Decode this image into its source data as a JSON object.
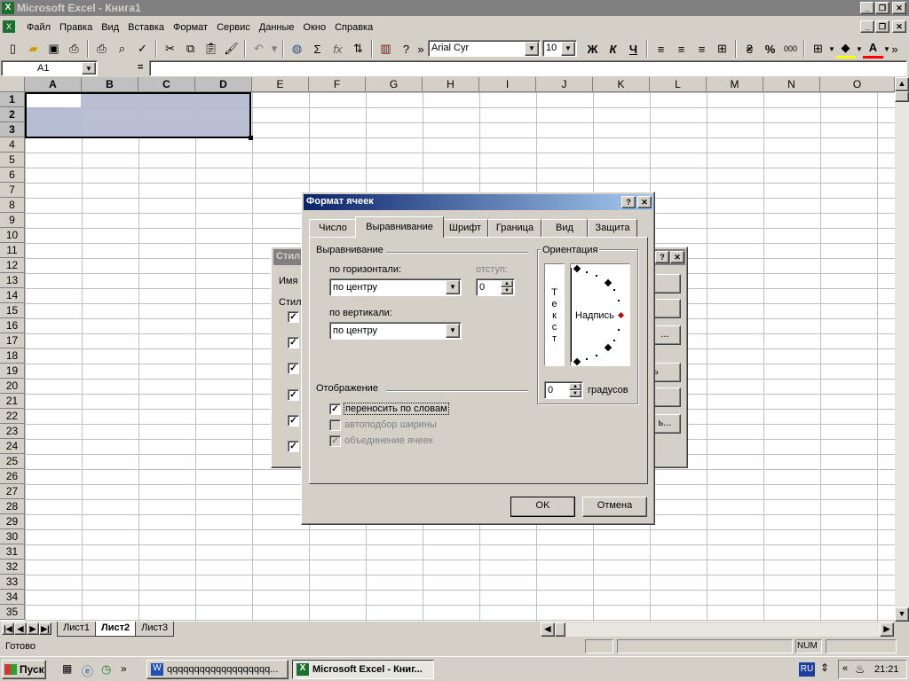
{
  "app": {
    "title": "Microsoft Excel - Книга1"
  },
  "menu": [
    "Файл",
    "Правка",
    "Вид",
    "Вставка",
    "Формат",
    "Сервис",
    "Данные",
    "Окно",
    "Справка"
  ],
  "toolbar": {
    "font_name": "Arial Cyr",
    "font_size": "10",
    "bold": "Ж",
    "italic": "К",
    "underline": "Ч",
    "percent": "%",
    "thousands": "000",
    "sigma": "Σ",
    "fx": "fx"
  },
  "formula_bar": {
    "name_box": "A1",
    "equals": "="
  },
  "columns": [
    "A",
    "B",
    "C",
    "D",
    "E",
    "F",
    "G",
    "H",
    "I",
    "J",
    "K",
    "L",
    "M",
    "N",
    "O"
  ],
  "rows": [
    "1",
    "2",
    "3",
    "4",
    "5",
    "6",
    "7",
    "8",
    "9",
    "10",
    "11",
    "12",
    "13",
    "14",
    "15",
    "16",
    "17",
    "18",
    "19",
    "20",
    "21",
    "22",
    "23",
    "24",
    "25",
    "26",
    "27",
    "28",
    "29",
    "30",
    "31",
    "32",
    "33",
    "34",
    "35"
  ],
  "sheet_tabs": [
    "Лист1",
    "Лист2",
    "Лист3"
  ],
  "active_sheet": "Лист2",
  "status": {
    "left": "Готово",
    "num": "NUM"
  },
  "style_dialog": {
    "title": "Стил",
    "name_label": "Имя с",
    "styles_label": "Стил",
    "btn_ellipsis_1": "...",
    "btn_ellipsis_2": "ь...",
    "btn_partial": "ь"
  },
  "format_dialog": {
    "title": "Формат ячеек",
    "help": "?",
    "close": "✕",
    "tabs": [
      "Число",
      "Выравнивание",
      "Шрифт",
      "Граница",
      "Вид",
      "Защита"
    ],
    "active_tab": "Выравнивание",
    "alignment_group": "Выравнивание",
    "horizontal_label": "по горизонтали:",
    "horizontal_value": "по центру",
    "indent_label": "отступ:",
    "indent_value": "0",
    "vertical_label": "по вертикали:",
    "vertical_value": "по центру",
    "orientation_group": "Ориентация",
    "vertical_text": [
      "Т",
      "е",
      "к",
      "с",
      "т"
    ],
    "orientation_label": "Надпись",
    "degrees_value": "0",
    "degrees_label": "градусов",
    "display_group": "Отображение",
    "wrap_label": "переносить по словам",
    "wrap_checked": true,
    "shrink_label": "автоподбор ширины",
    "merge_label": "объединение ячеек",
    "ok": "OK",
    "cancel": "Отмена"
  },
  "taskbar": {
    "start": "Пуск",
    "task_word": "qqqqqqqqqqqqqqqqqqq...",
    "task_excel": "Microsoft Excel - Книг...",
    "lang": "RU",
    "time": "21:21",
    "more": "»"
  },
  "colors": {
    "selection": "#b6bcd2",
    "titlebar_inactive": "#808080",
    "dialog_active": "#0a246a",
    "taskbar": "#d4d0c8"
  }
}
